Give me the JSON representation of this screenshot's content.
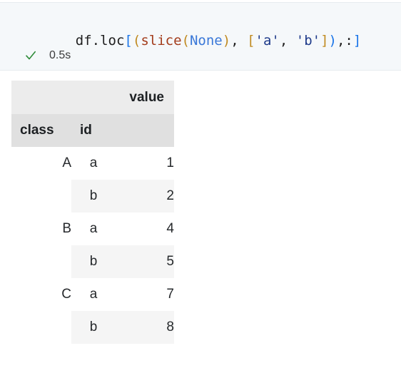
{
  "cell": {
    "code_tokens": [
      {
        "text": "df.loc",
        "kind": "plain"
      },
      {
        "text": "[",
        "kind": "bracket-blue"
      },
      {
        "text": "(",
        "kind": "bracket-gold"
      },
      {
        "text": "slice",
        "kind": "function"
      },
      {
        "text": "(",
        "kind": "bracket-gold"
      },
      {
        "text": "None",
        "kind": "constant"
      },
      {
        "text": ")",
        "kind": "bracket-gold"
      },
      {
        "text": ", ",
        "kind": "plain"
      },
      {
        "text": "[",
        "kind": "bracket-gold"
      },
      {
        "text": "'a'",
        "kind": "string"
      },
      {
        "text": ", ",
        "kind": "plain"
      },
      {
        "text": "'b'",
        "kind": "string"
      },
      {
        "text": "]",
        "kind": "bracket-gold"
      },
      {
        "text": ")",
        "kind": "bracket-blue"
      },
      {
        "text": ",:",
        "kind": "plain"
      },
      {
        "text": "]",
        "kind": "bracket-blue"
      }
    ],
    "code_text": "df.loc[(slice(None), ['a', 'b']),:]",
    "status_icon": "checkmark-icon",
    "status_color": "#2e8b38",
    "elapsed": "0.5s"
  },
  "table": {
    "value_header": "value",
    "index_headers": [
      "class",
      "id"
    ],
    "rows": [
      {
        "class": "A",
        "id": "a",
        "value": "1",
        "striped": false
      },
      {
        "class": "",
        "id": "b",
        "value": "2",
        "striped": true
      },
      {
        "class": "B",
        "id": "a",
        "value": "4",
        "striped": false
      },
      {
        "class": "",
        "id": "b",
        "value": "5",
        "striped": true
      },
      {
        "class": "C",
        "id": "a",
        "value": "7",
        "striped": false
      },
      {
        "class": "",
        "id": "b",
        "value": "8",
        "striped": true
      }
    ],
    "colors": {
      "header_top_bg": "#ececec",
      "header_index_bg": "#e0e0e0",
      "stripe_bg": "#f5f5f5",
      "text": "#26292c"
    }
  }
}
